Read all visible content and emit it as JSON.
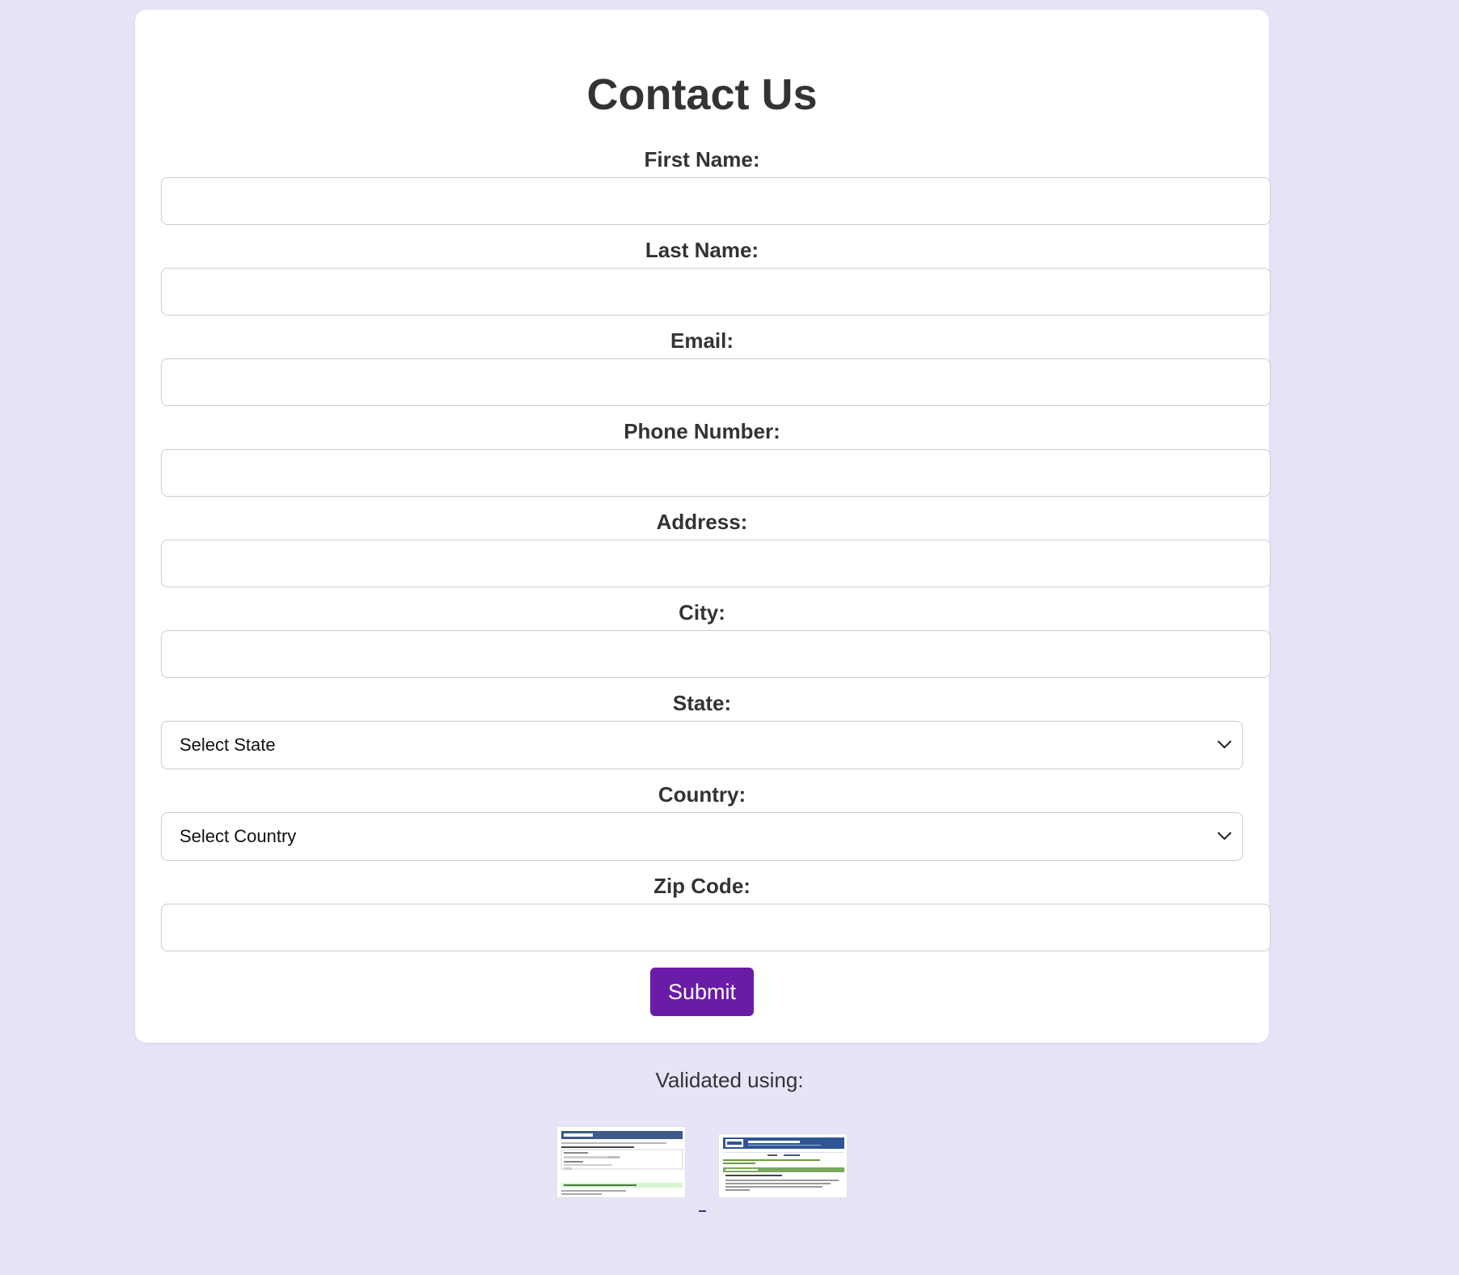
{
  "form": {
    "title": "Contact Us",
    "fields": {
      "first_name": {
        "label": "First Name:",
        "value": "",
        "placeholder": ""
      },
      "last_name": {
        "label": "Last Name:",
        "value": "",
        "placeholder": ""
      },
      "email": {
        "label": "Email:",
        "value": "",
        "placeholder": ""
      },
      "phone": {
        "label": "Phone Number:",
        "value": "",
        "placeholder": ""
      },
      "address": {
        "label": "Address:",
        "value": "",
        "placeholder": ""
      },
      "city": {
        "label": "City:",
        "value": "",
        "placeholder": ""
      },
      "state": {
        "label": "State:",
        "selected": "Select State"
      },
      "country": {
        "label": "Country:",
        "selected": "Select Country"
      },
      "zip": {
        "label": "Zip Code:",
        "value": "",
        "placeholder": ""
      }
    },
    "submit_label": "Submit"
  },
  "footer": {
    "validated_text": "Validated using:",
    "badges": [
      {
        "name": "Nu Html Checker",
        "icon": "html-validator-screenshot-icon"
      },
      {
        "name": "The W3C CSS Validation Service",
        "icon": "css-validator-screenshot-icon"
      }
    ]
  },
  "colors": {
    "page_background": "#e6e4f7",
    "card_background": "#ffffff",
    "text": "#333333",
    "input_border": "#cccccc",
    "submit_background": "#6a1ba8",
    "submit_text": "#ffffff"
  }
}
